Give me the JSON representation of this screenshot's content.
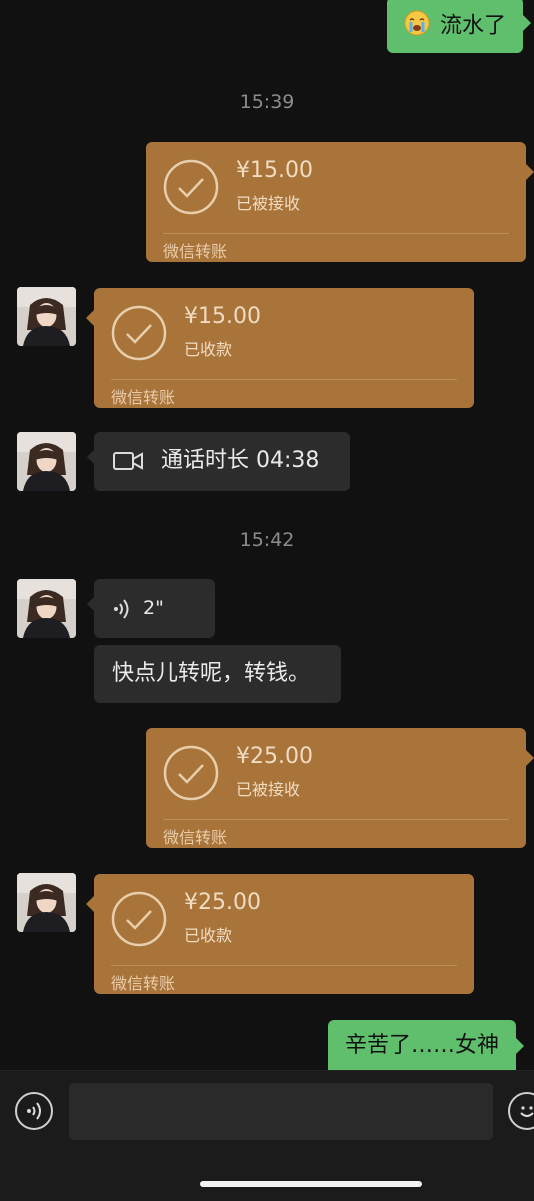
{
  "messages": {
    "m1": {
      "text": "流水了",
      "emoji": "crying-face-icon"
    },
    "t1": {
      "text": "15:39"
    },
    "tr1": {
      "amount": "¥15.00",
      "status": "已被接收",
      "source": "微信转账"
    },
    "tr2": {
      "amount": "¥15.00",
      "status": "已收款",
      "source": "微信转账"
    },
    "call": {
      "text": "通话时长 04:38",
      "icon": "video-call-icon"
    },
    "t2": {
      "text": "15:42"
    },
    "voice": {
      "duration": "2\"",
      "icon": "voice-wave-icon"
    },
    "text1": {
      "text": "快点儿转呢，转钱。"
    },
    "tr3": {
      "amount": "¥25.00",
      "status": "已被接收",
      "source": "微信转账"
    },
    "tr4": {
      "amount": "¥25.00",
      "status": "已收款",
      "source": "微信转账"
    },
    "m2": {
      "text": "辛苦了……女神"
    }
  },
  "input_bar": {
    "placeholder": ""
  },
  "colors": {
    "background": "#111111",
    "outgoing": "#5fbf6c",
    "incoming": "#2c2c2c",
    "transfer": "#a8743a"
  }
}
